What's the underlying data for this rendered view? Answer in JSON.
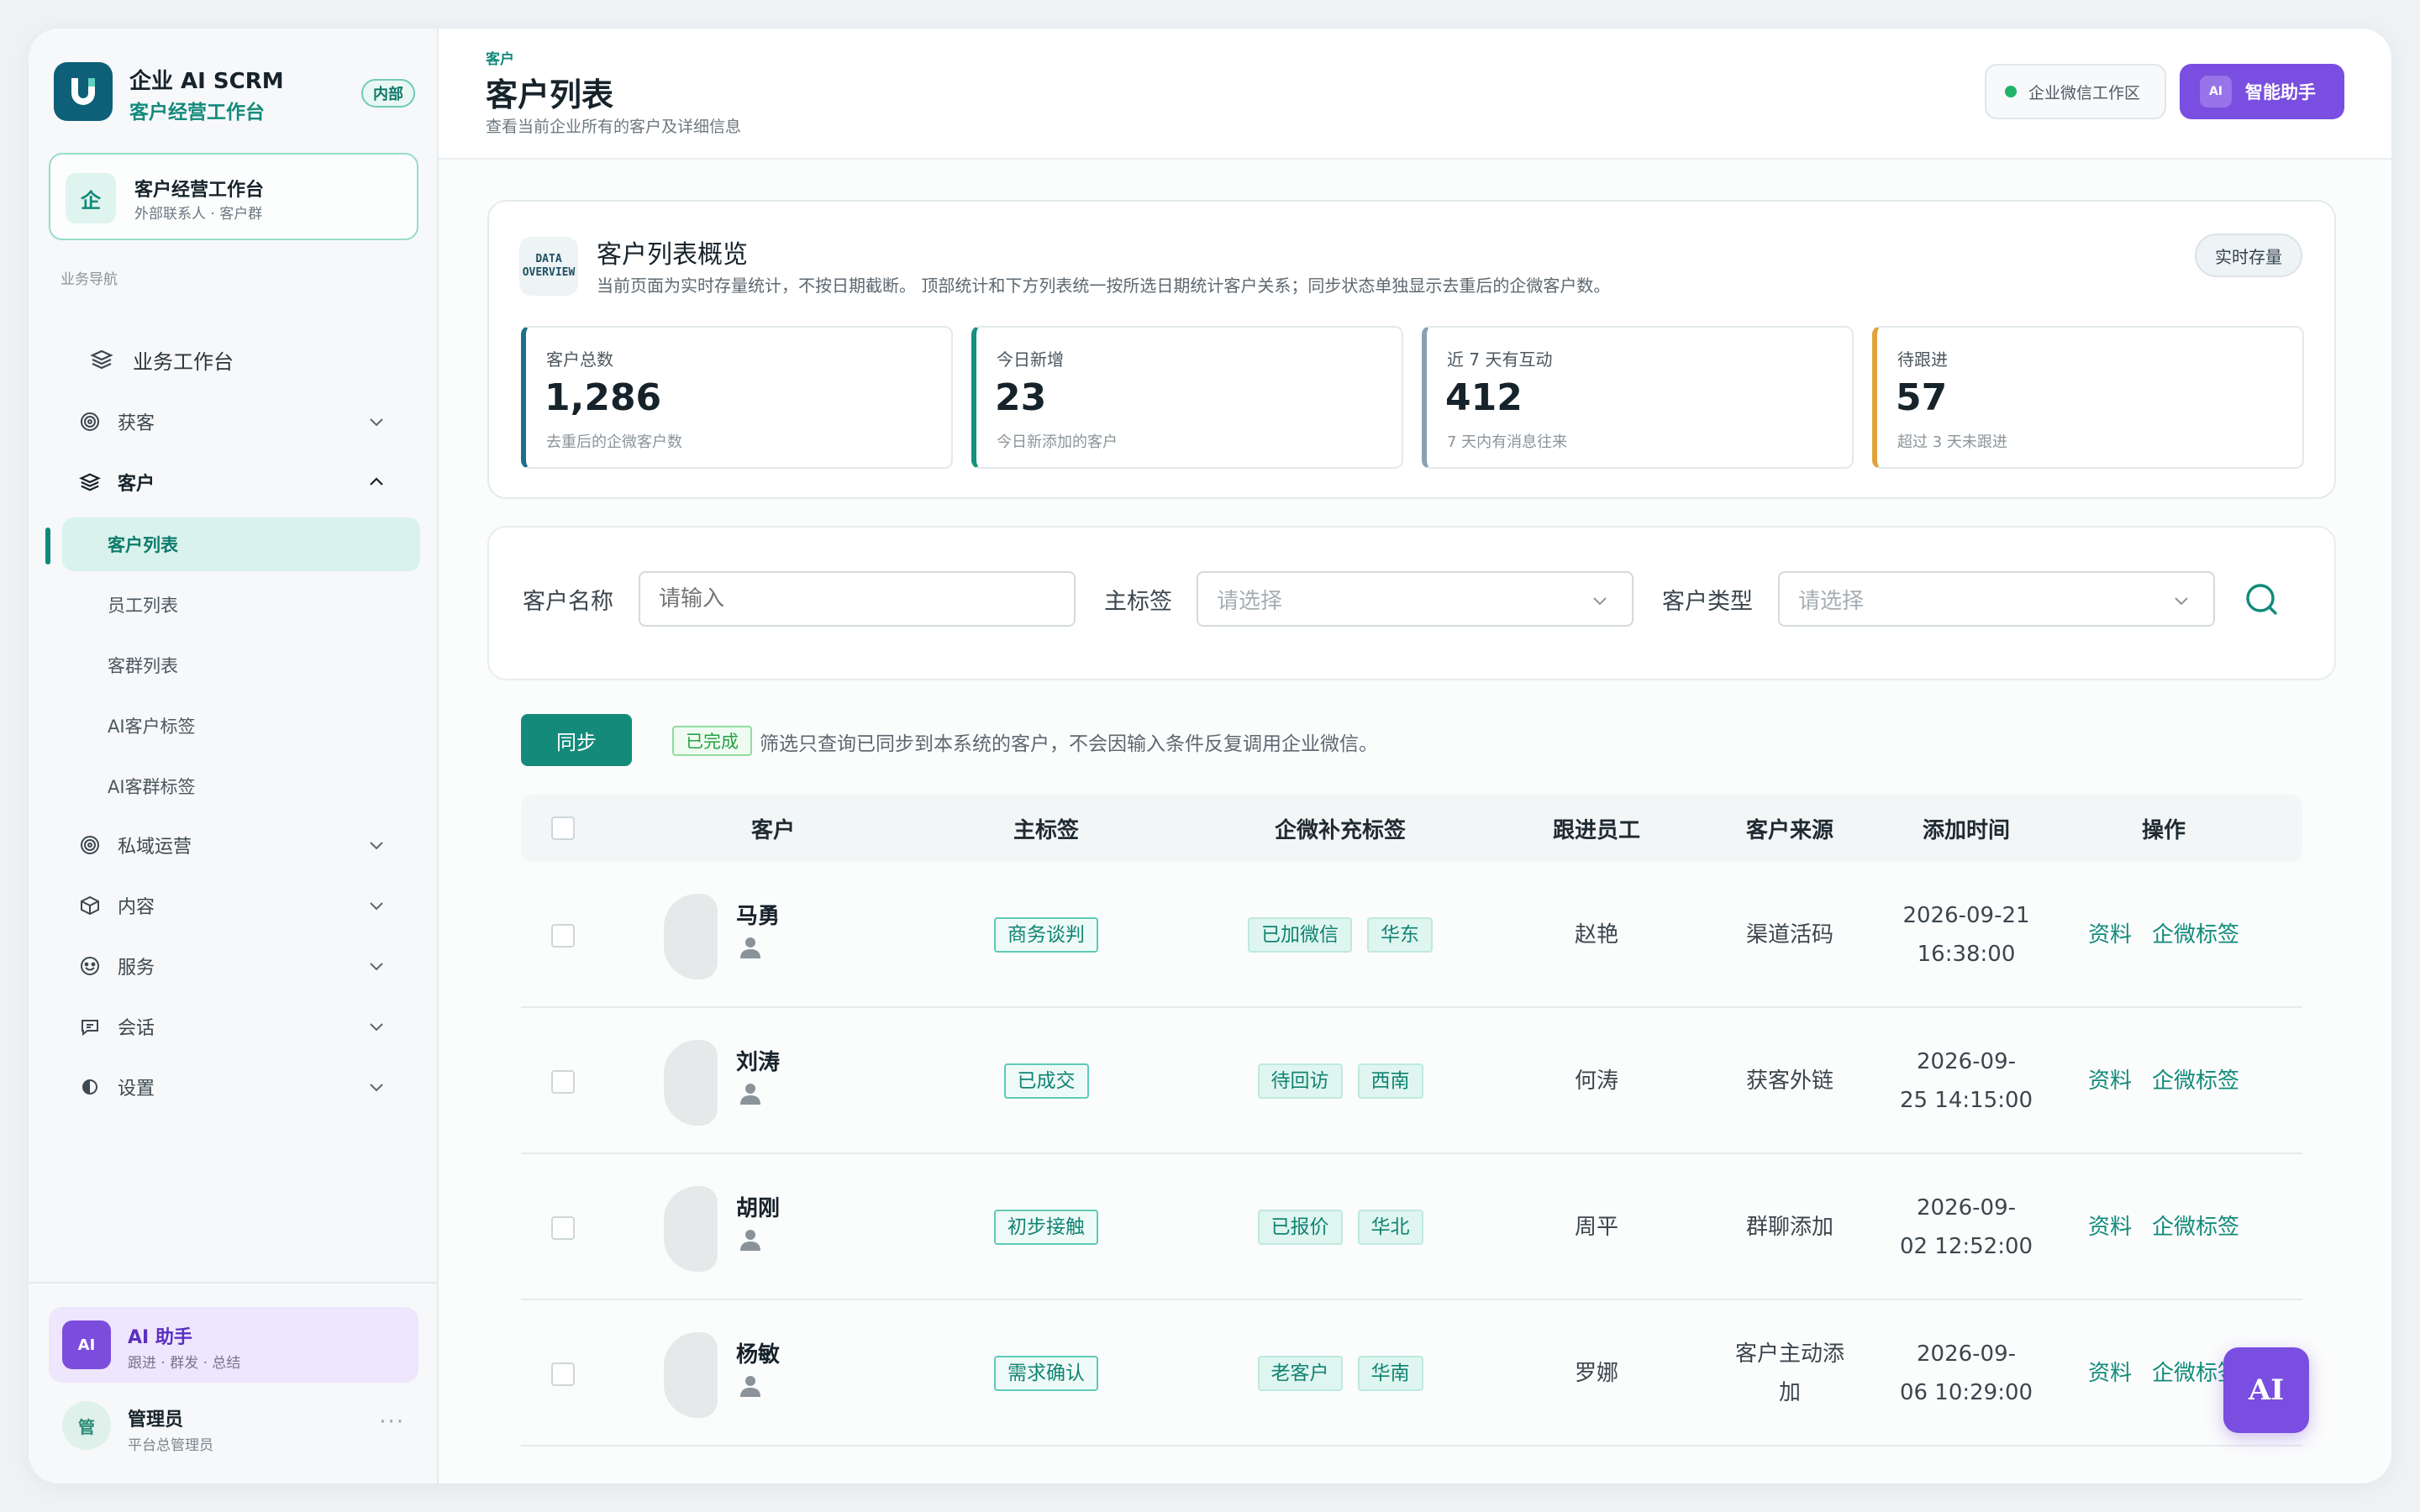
{
  "brand": {
    "title": "企业 AI SCRM",
    "subtitle": "客户经营工作台",
    "badge": "内部"
  },
  "workspace": {
    "icon_char": "企",
    "title": "客户经营工作台",
    "subtitle": "外部联系人 · 客户群"
  },
  "nav": {
    "section_label": "业务导航",
    "top_item": "业务工作台",
    "groups": [
      {
        "label": "获客",
        "icon": "target-icon"
      },
      {
        "label": "客户",
        "icon": "layers-icon"
      }
    ],
    "customer_sub": [
      "客户列表",
      "员工列表",
      "客群列表",
      "AI客户标签",
      "AI客群标签"
    ],
    "more_groups": [
      {
        "label": "私域运营",
        "icon": "target-icon"
      },
      {
        "label": "内容",
        "icon": "box-icon"
      },
      {
        "label": "服务",
        "icon": "smile-icon"
      },
      {
        "label": "会话",
        "icon": "chat-icon"
      },
      {
        "label": "设置",
        "icon": "settings-icon"
      }
    ]
  },
  "ai_card": {
    "icon_text": "AI",
    "title": "AI 助手",
    "subtitle": "跟进 · 群发 · 总结"
  },
  "user": {
    "avatar_char": "管",
    "name": "管理员",
    "role": "平台总管理员",
    "more": "···"
  },
  "header": {
    "breadcrumb": "客户",
    "title": "客户列表",
    "description": "查看当前企业所有的客户及详细信息",
    "env_label": "企业微信工作区",
    "ai_button_icon": "AI",
    "ai_button_label": "智能助手"
  },
  "overview": {
    "icon_line1": "DATA",
    "icon_line2": "OVERVIEW",
    "title": "客户列表概览",
    "description": "当前页面为实时存量统计，不按日期截断。 顶部统计和下方列表统一按所选日期统计客户关系；同步状态单独显示去重后的企微客户数。",
    "badge": "实时存量",
    "stats": [
      {
        "label": "客户总数",
        "value": "1,286",
        "note": "去重后的企微客户数",
        "color": "#1e6f88"
      },
      {
        "label": "今日新增",
        "value": "23",
        "note": "今日新添加的客户",
        "color": "#16907f"
      },
      {
        "label": "近 7 天有互动",
        "value": "412",
        "note": "7 天内有消息往来",
        "color": "#8aa0b4"
      },
      {
        "label": "待跟进",
        "value": "57",
        "note": "超过 3 天未跟进",
        "color": "#e0a33a"
      }
    ]
  },
  "filters": {
    "name_label": "客户名称",
    "name_placeholder": "请输入",
    "tag_label": "主标签",
    "tag_placeholder": "请选择",
    "type_label": "客户类型",
    "type_placeholder": "请选择"
  },
  "sync": {
    "button": "同步",
    "status": "已完成",
    "note": "筛选只查询已同步到本系统的客户，不会因输入条件反复调用企业微信。"
  },
  "table": {
    "headers": [
      "客户",
      "主标签",
      "企微补充标签",
      "跟进员工",
      "客户来源",
      "添加时间",
      "操作"
    ],
    "actions": [
      "资料",
      "企微标签"
    ],
    "rows": [
      {
        "name": "马勇",
        "main_tag": "商务谈判",
        "extra_tags": [
          "已加微信",
          "华东"
        ],
        "staff": "赵艳",
        "source": "渠道活码",
        "time_1": "2026-09-21",
        "time_2": "16:38:00"
      },
      {
        "name": "刘涛",
        "main_tag": "已成交",
        "extra_tags": [
          "待回访",
          "西南"
        ],
        "staff": "何涛",
        "source": "获客外链",
        "time_1": "2026-09-",
        "time_2": "25 14:15:00"
      },
      {
        "name": "胡刚",
        "main_tag": "初步接触",
        "extra_tags": [
          "已报价",
          "华北"
        ],
        "staff": "周平",
        "source": "群聊添加",
        "time_1": "2026-09-",
        "time_2": "02 12:52:00"
      },
      {
        "name": "杨敏",
        "main_tag": "需求确认",
        "extra_tags": [
          "老客户",
          "华南"
        ],
        "staff": "罗娜",
        "source_1": "客户主动添",
        "source_2": "加",
        "time_1": "2026-09-",
        "time_2": "06 10:29:00"
      }
    ]
  },
  "float_ai": "AI",
  "colors": {
    "brand": "#118a7b",
    "accent_purple": "#7a4ee0"
  }
}
